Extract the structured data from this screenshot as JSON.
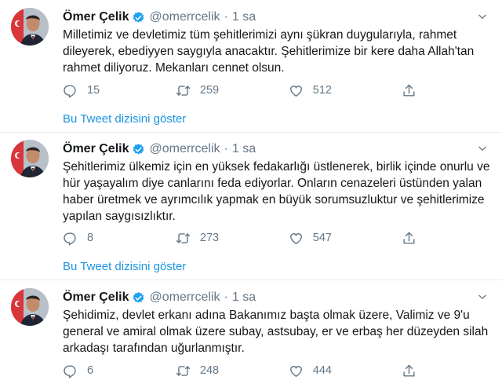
{
  "tweets": [
    {
      "name": "Ömer Çelik",
      "handle": "@omerrcelik",
      "dot": "·",
      "time": "1 sa",
      "text": "Milletimiz ve devletimiz tüm şehitlerimizi aynı şükran duygularıyla, rahmet dileyerek, ebediyyen saygıyla anacaktır. Şehitlerimize bir kere daha Allah'tan rahmet diliyoruz. Mekanları cennet olsun.",
      "replies": "15",
      "retweets": "259",
      "likes": "512",
      "show_thread": "Bu Tweet dizisini göster"
    },
    {
      "name": "Ömer Çelik",
      "handle": "@omerrcelik",
      "dot": "·",
      "time": "1 sa",
      "text": "Şehitlerimiz ülkemiz için en yüksek fedakarlığı üstlenerek, birlik içinde onurlu ve hür yaşayalım diye canlarını feda ediyorlar. Onların cenazeleri üstünden yalan haber üretmek ve ayrımcılık yapmak en büyük sorumsuzluktur ve şehitlerimize yapılan saygısızlıktır.",
      "replies": "8",
      "retweets": "273",
      "likes": "547",
      "show_thread": "Bu Tweet dizisini göster"
    },
    {
      "name": "Ömer Çelik",
      "handle": "@omerrcelik",
      "dot": "·",
      "time": "1 sa",
      "text": "Şehidimiz, devlet erkanı adına Bakanımız başta olmak üzere, Valimiz ve 9'u general ve amiral olmak üzere subay, astsubay, er ve erbaş her düzeyden silah arkadaşı tarafından uğurlanmıştır.",
      "replies": "6",
      "retweets": "248",
      "likes": "444"
    }
  ],
  "colors": {
    "accent": "#1b95e0",
    "muted": "#657786",
    "text": "#14171a",
    "verified": "#1da1f2"
  },
  "icons": [
    "avatar",
    "verified-badge-icon",
    "chevron-down-icon",
    "reply-icon",
    "retweet-icon",
    "like-icon",
    "share-icon"
  ]
}
